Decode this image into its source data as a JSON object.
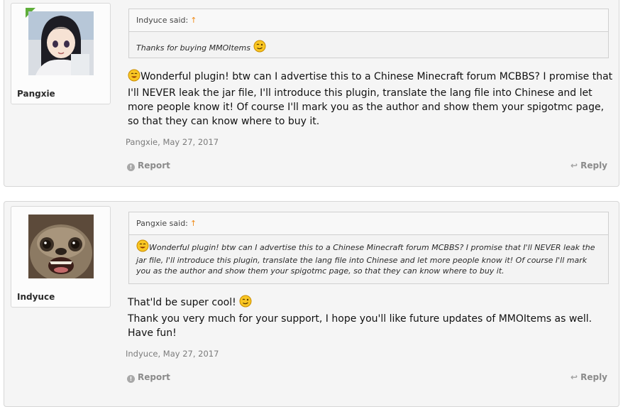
{
  "posts": [
    {
      "username": "Pangxie",
      "quote_author": "Indyuce said:",
      "quote_text": "Thanks for buying MMOItems",
      "message_lines": [
        "Wonderful plugin! btw can I advertise this to a Chinese Minecraft forum MCBBS? I promise that I'll NEVER leak the jar file, I'll introduce this plugin, translate the lang file into Chinese and let more people know it! Of course I'll mark you as the author and show them your spigotmc page, so that they can know where to buy it."
      ],
      "meta": "Pangxie, May 27, 2017",
      "report_label": "Report",
      "reply_label": "Reply"
    },
    {
      "username": "Indyuce",
      "quote_author": "Pangxie said:",
      "quote_text": "Wonderful plugin! btw can I advertise this to a Chinese Minecraft forum MCBBS? I promise that I'll NEVER leak the jar file, I'll introduce this plugin, translate the lang file into Chinese and let more people know it! Of course I'll mark you as the author and show them your spigotmc page, so that they can know where to buy it.",
      "message_line1": "That'ld be super cool!",
      "message_line2": "Thank you very much for your support, I hope you'll like future updates of MMOItems as well.",
      "message_line3": "Have fun!",
      "meta": "Indyuce, May 27, 2017",
      "report_label": "Report",
      "reply_label": "Reply"
    }
  ],
  "colors": {
    "accent_arrow": "#f08c1a",
    "badge": "#5fae3a",
    "post_bg": "#f5f5f5"
  }
}
